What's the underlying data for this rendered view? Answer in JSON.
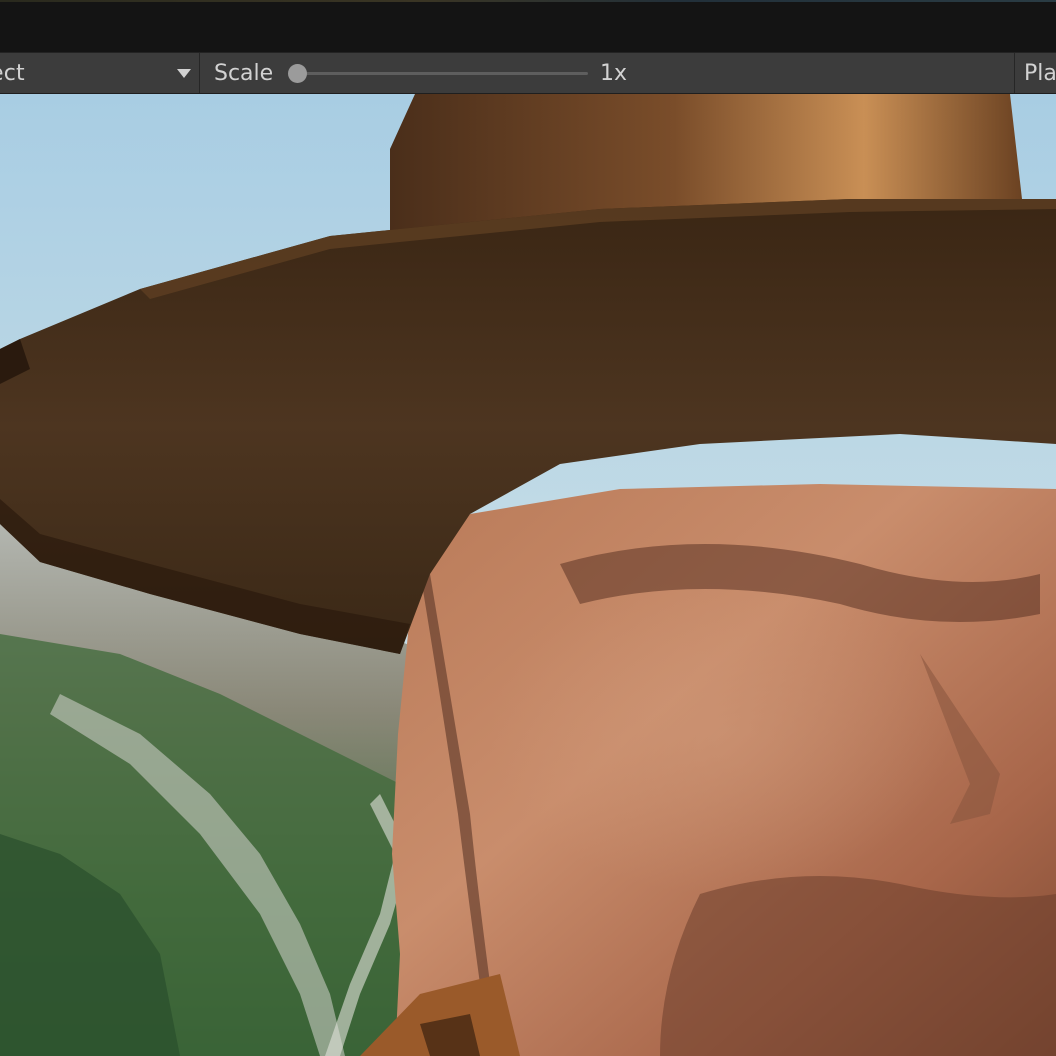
{
  "toolbar": {
    "view_dropdown": {
      "value": "ect",
      "chevron_icon": "chevron-down-icon"
    },
    "scale": {
      "label": "Scale",
      "value_label": "1x",
      "slider_fraction": 0.0
    },
    "play_dropdown": {
      "label": "Pla"
    }
  },
  "viewport": {
    "content": "rendered 3D scene"
  },
  "colors": {
    "toolbar_bg": "#3c3c3c",
    "titlebar_bg": "#141414",
    "text": "#d2d2d2"
  }
}
